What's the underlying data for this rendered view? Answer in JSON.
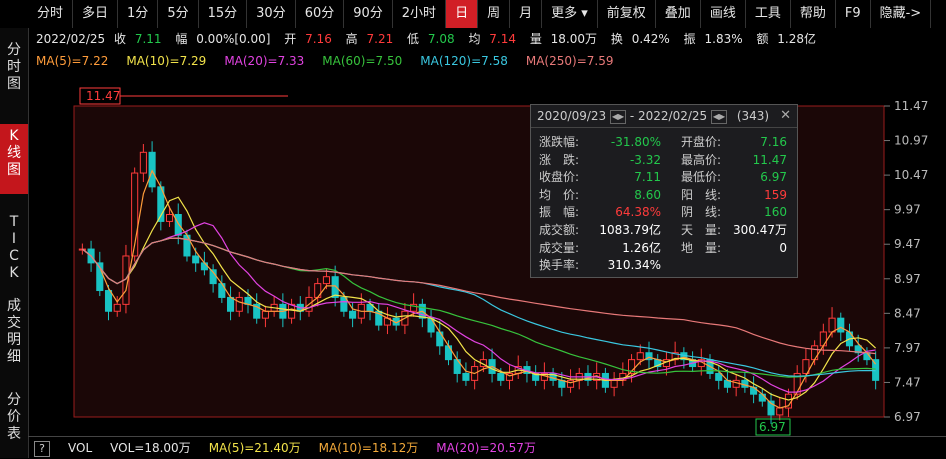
{
  "toolbar": [
    "分时",
    "多日",
    "1分",
    "5分",
    "15分",
    "30分",
    "60分",
    "90分",
    "2小时",
    "日",
    "周",
    "月",
    "更多",
    "前复权",
    "叠加",
    "画线",
    "工具",
    "帮助",
    "F9",
    "隐藏->"
  ],
  "toolbar_active": 9,
  "sidebar": [
    {
      "label": "分时图",
      "active": false
    },
    {
      "label": "K线图",
      "active": true
    },
    {
      "label": "TICK",
      "active": false
    },
    {
      "label": "成交明细",
      "active": false
    },
    {
      "label": "分价表",
      "active": false
    }
  ],
  "info": {
    "date": "2022/02/25",
    "close_label": "收",
    "close": "7.11",
    "change_label": "幅",
    "change": "0.00%[0.00]",
    "open_label": "开",
    "open": "7.16",
    "high_label": "高",
    "high": "7.21",
    "low_label": "低",
    "low": "7.08",
    "avg_label": "均",
    "avg": "7.14",
    "vol_label": "量",
    "vol": "18.00万",
    "turnover_label": "换",
    "turnover": "0.42%",
    "amp_label": "振",
    "amp": "1.83%",
    "amt_label": "额",
    "amt": "1.28亿"
  },
  "ma": [
    {
      "label": "MA(5)=7.22",
      "color": "#ff9c3a"
    },
    {
      "label": "MA(10)=7.29",
      "color": "#f2e34a"
    },
    {
      "label": "MA(20)=7.33",
      "color": "#e243e2"
    },
    {
      "label": "MA(60)=7.50",
      "color": "#37c23c"
    },
    {
      "label": "MA(120)=7.58",
      "color": "#3ac7e0"
    },
    {
      "label": "MA(250)=7.59",
      "color": "#e87979"
    }
  ],
  "panel": {
    "start": "2020/09/23",
    "sep": "-",
    "end": "2022/02/25",
    "count": "(343)",
    "rows": [
      {
        "l1": "涨跌幅:",
        "v1": "-31.80%",
        "c1": "#23c84c",
        "l2": "开盘价:",
        "v2": "7.16",
        "c2": "#23c84c"
      },
      {
        "l1": "涨　跌:",
        "v1": "-3.32",
        "c1": "#23c84c",
        "l2": "最高价:",
        "v2": "11.47",
        "c2": "#23c84c"
      },
      {
        "l1": "收盘价:",
        "v1": "7.11",
        "c1": "#23c84c",
        "l2": "最低价:",
        "v2": "6.97",
        "c2": "#23c84c"
      },
      {
        "l1": "均　价:",
        "v1": "8.60",
        "c1": "#23c84c",
        "l2": "阳　线:",
        "v2": "159",
        "c2": "#ff3b3b"
      },
      {
        "l1": "振　幅:",
        "v1": "64.38%",
        "c1": "#ff3b3b",
        "l2": "阴　线:",
        "v2": "160",
        "c2": "#23c84c"
      },
      {
        "l1": "成交额:",
        "v1": "1083.79亿",
        "c1": "#ffffff",
        "l2": "天　量:",
        "v2": "300.47万",
        "c2": "#ffffff"
      },
      {
        "l1": "成交量:",
        "v1": "1.26亿",
        "c1": "#ffffff",
        "l2": "地　量:",
        "v2": "0",
        "c2": "#ffffff"
      },
      {
        "l1": "换手率:",
        "v1": "310.34%",
        "c1": "#ffffff",
        "l2": "",
        "v2": "",
        "c2": "#ffffff"
      }
    ]
  },
  "volume": {
    "help": "?",
    "items": [
      {
        "label": "VOL",
        "color": "#e6e6e6"
      },
      {
        "label": "VOL=18.00万",
        "color": "#e6e6e6"
      },
      {
        "label": "MA(5)=21.40万",
        "color": "#f2e34a"
      },
      {
        "label": "MA(10)=18.12万",
        "color": "#f2a93a"
      },
      {
        "label": "MA(20)=20.57万",
        "color": "#e243e2"
      }
    ]
  },
  "chart_data": {
    "type": "candlestick",
    "y_ticks": [
      "11.47",
      "10.97",
      "10.47",
      "9.97",
      "9.47",
      "8.97",
      "8.47",
      "7.97",
      "7.47",
      "6.97"
    ],
    "ylim": [
      6.97,
      11.47
    ],
    "range": {
      "start": "2020/09/23",
      "end": "2022/02/25",
      "bars": 343
    },
    "marker_high": "11.47",
    "marker_low": "6.97",
    "closes": [
      9.4,
      9.2,
      8.8,
      8.5,
      8.6,
      9.3,
      10.5,
      10.8,
      10.3,
      9.8,
      9.9,
      9.6,
      9.3,
      9.2,
      9.1,
      8.9,
      8.7,
      8.5,
      8.7,
      8.6,
      8.4,
      8.5,
      8.6,
      8.4,
      8.6,
      8.5,
      8.7,
      8.9,
      9.0,
      8.7,
      8.5,
      8.4,
      8.6,
      8.5,
      8.3,
      8.4,
      8.3,
      8.5,
      8.6,
      8.4,
      8.2,
      8.0,
      7.8,
      7.6,
      7.5,
      7.7,
      7.8,
      7.6,
      7.5,
      7.6,
      7.7,
      7.6,
      7.5,
      7.6,
      7.5,
      7.4,
      7.5,
      7.6,
      7.5,
      7.6,
      7.4,
      7.5,
      7.6,
      7.8,
      7.9,
      7.8,
      7.7,
      7.8,
      7.9,
      7.8,
      7.7,
      7.8,
      7.6,
      7.5,
      7.4,
      7.5,
      7.4,
      7.3,
      7.2,
      7.0,
      7.1,
      7.3,
      7.6,
      7.8,
      8.0,
      8.2,
      8.4,
      8.2,
      8.0,
      7.9,
      7.8,
      7.5
    ]
  }
}
